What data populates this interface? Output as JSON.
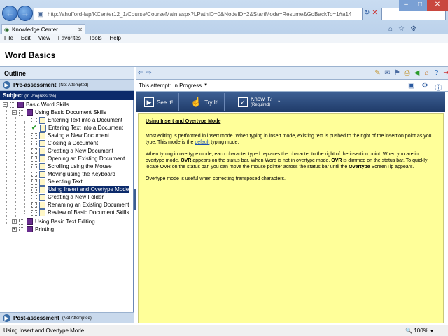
{
  "browser": {
    "back_icon": "back-arrow-icon",
    "forward_icon": "forward-arrow-icon",
    "address": "http://ahufford-lap/KCenter12_1/Course/CourseMain.aspx?LPathID=0&NodeID=2&StartMode=Resume&GoBackTo=1#a14",
    "tab_title": "Knowledge Center",
    "menu": [
      "File",
      "Edit",
      "View",
      "Favorites",
      "Tools",
      "Help"
    ]
  },
  "app": {
    "title": "Word Basics"
  },
  "outline": {
    "header": "Outline",
    "pre_assessment": {
      "label": "Pre-assessment",
      "status": "(Not Attempted)"
    },
    "subject": {
      "label": "Subject",
      "status": "(In Progress 3%)"
    },
    "items": [
      {
        "label": "Basic Word Skills"
      },
      {
        "label": "Using Basic Document Skills"
      },
      {
        "label": "Entering Text into a Document"
      },
      {
        "label": "Entering Text into a Document"
      },
      {
        "label": "Saving a New Document"
      },
      {
        "label": "Closing a Document"
      },
      {
        "label": "Creating a New Document"
      },
      {
        "label": "Opening an Existing Document"
      },
      {
        "label": "Scrolling using the Mouse"
      },
      {
        "label": "Moving using the Keyboard"
      },
      {
        "label": "Selecting Text"
      },
      {
        "label": "Using Insert and Overtype Mode"
      },
      {
        "label": "Creating a New Folder"
      },
      {
        "label": "Renaming an Existing Document"
      },
      {
        "label": "Review of Basic Document Skills"
      },
      {
        "label": "Using Basic Text Editing"
      },
      {
        "label": "Printing"
      }
    ],
    "post_assessment": {
      "label": "Post-assessment",
      "status": "(Not Attempted)"
    }
  },
  "main": {
    "attempt_label": "This attempt:",
    "attempt_value": "In Progress",
    "modes": {
      "see_it": "See It!",
      "try_it": "Try It!",
      "know_it": "Know It?",
      "know_it_required": "(Required)"
    },
    "content": {
      "title": "Using Insert and Overtype Mode",
      "p1a": "Most editing is performed in insert mode. When typing in insert mode, existing text is pushed to the right of the insertion point as you type. This mode is the",
      "p1_link": "default",
      "p1b": "typing mode.",
      "p2a": "When typing in overtype mode, each character typed replaces the character to the right of the insertion point. When you are in overtype mode,",
      "ovr1": "OVR",
      "p2b": "appears on the status bar. When Word is not in overtype mode,",
      "ovr2": "OVR",
      "p2c": "is dimmed on the status bar. To quickly locate OVR on the status bar, you can move the mouse pointer across the status bar until the",
      "overtype": "Overtype",
      "p2d": "ScreenTip appears.",
      "p3": "Overtype mode is useful when correcting transposed characters."
    }
  },
  "status": {
    "text": "Using Insert and Overtype Mode",
    "zoom": "100%"
  }
}
